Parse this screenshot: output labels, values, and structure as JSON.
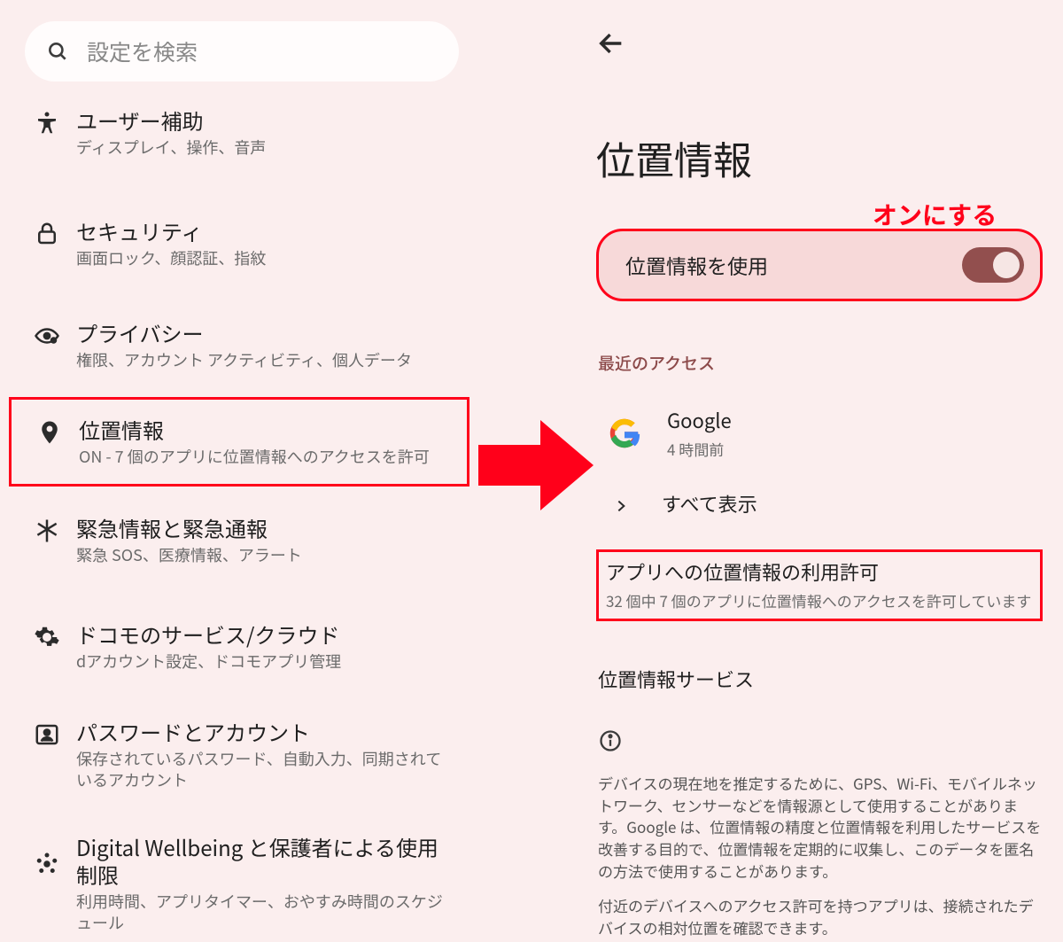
{
  "left": {
    "search_placeholder": "設定を検索",
    "items": [
      {
        "title": "ユーザー補助",
        "sub": "ディスプレイ、操作、音声"
      },
      {
        "title": "セキュリティ",
        "sub": "画面ロック、顔認証、指紋"
      },
      {
        "title": "プライバシー",
        "sub": "権限、アカウント アクティビティ、個人データ"
      },
      {
        "title": "位置情報",
        "sub": "ON - 7 個のアプリに位置情報へのアクセスを許可"
      },
      {
        "title": "緊急情報と緊急通報",
        "sub": "緊急 SOS、医療情報、アラート"
      },
      {
        "title": "ドコモのサービス/クラウド",
        "sub": "dアカウント設定、ドコモアプリ管理"
      },
      {
        "title": "パスワードとアカウント",
        "sub": "保存されているパスワード、自動入力、同期されているアカウント"
      },
      {
        "title": "Digital Wellbeing と保護者による使用制限",
        "sub": "利用時間、アプリタイマー、おやすみ時間のスケジュール"
      }
    ]
  },
  "right": {
    "title": "位置情報",
    "callout": "オンにする",
    "toggle_label": "位置情報を使用",
    "toggle_on": true,
    "recent_header": "最近のアクセス",
    "recent_app": "Google",
    "recent_time": "4 時間前",
    "show_all": "すべて表示",
    "app_perm_title": "アプリへの位置情報の利用許可",
    "app_perm_sub": "32 個中 7 個のアプリに位置情報へのアクセスを許可しています",
    "loc_services": "位置情報サービス",
    "info1": "デバイスの現在地を推定するために、GPS、Wi-Fi、モバイルネットワーク、センサーなどを情報源として使用することがあります。Google は、位置情報の精度と位置情報を利用したサービスを改善する目的で、位置情報を定期的に収集し、このデータを匿名の方法で使用することがあります。",
    "info2": "付近のデバイスへのアクセス許可を持つアプリは、接続されたデバイスの相対位置を確認できます。"
  }
}
